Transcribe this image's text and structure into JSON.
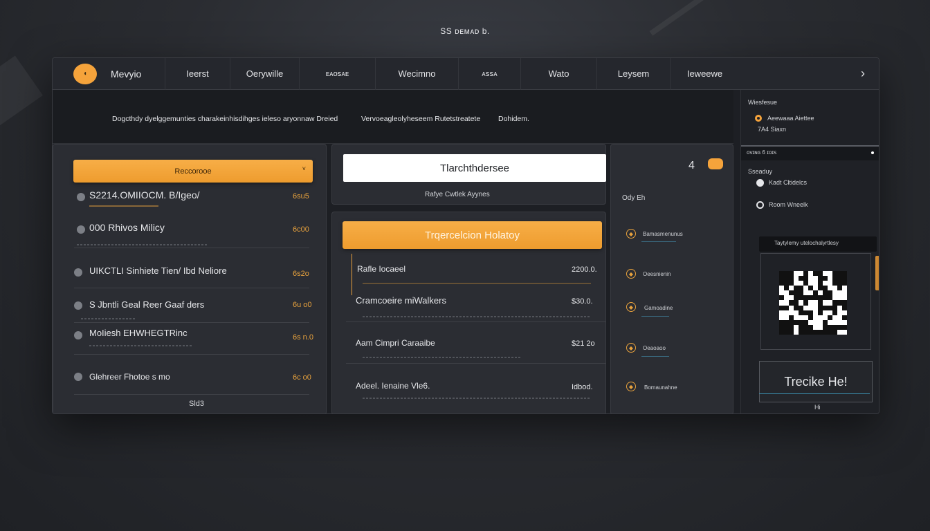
{
  "page": {
    "caption": "SS ᴅᴇᴍᴀᴅ b."
  },
  "nav": {
    "brand": "Mevyio",
    "tabs": [
      "Ieerst",
      "Oerywille",
      "ᴇᴀᴏꜱᴀᴇ",
      "Wecimno",
      "ᴀꜱꜱᴀ",
      "Wato",
      "Leysem",
      "Ieweewe"
    ],
    "next_icon": "chevron-right-icon"
  },
  "banner": {
    "text_left": "Dogcthdy dyelggemunties charakeinhisdihges ieleso aryonnaw Dreied",
    "text_mid": "Vervoeagleolyheseem Rutetstreatete",
    "text_right": "Dohidem."
  },
  "left_panel": {
    "button": "Reccorooe",
    "button_caret": "˅",
    "items": [
      {
        "label": "S2214.OMIIOCM. B/Igeo/",
        "value": "6su5"
      },
      {
        "label": "000 Rhivos Milicy",
        "value": "6c00"
      },
      {
        "label": "UIKCTLI Sinhiete Tien/ Ibd Neliore",
        "value": "6s2o"
      },
      {
        "label": "S Jbntli Geal Reer Gaaf ders",
        "value": "6u o0"
      },
      {
        "label": "MoIiesh EHWHEGTRinc",
        "value": "6s n.0"
      },
      {
        "label": "Glehreer Fhotoe s mo",
        "value": "6c o0"
      }
    ],
    "footer": "Sld3"
  },
  "mid_panel": {
    "search_value": "Tlarchthdersee",
    "search_sub": "Rafye Cwtlek Ayynes",
    "history_button": "Trqercelcion Holatoy",
    "transactions": [
      {
        "label": "Rafle Iocaeel",
        "amount": "2200.0."
      },
      {
        "label": "Cramcoeire miWalkers",
        "amount": "$30.0."
      },
      {
        "label": "Aam Cimpri Caraaibe",
        "amount": "$21 2o"
      },
      {
        "label": "Adeel. Ienaine Vle6.",
        "amount": "Idbod."
      }
    ]
  },
  "right_mid_panel": {
    "header_num": "4",
    "header_sub": "Ody  Eh",
    "items": [
      "Bamasmenunus",
      "Oeesnienin",
      "Gamoadine",
      "Oeaoaoo",
      "Bomaunahne"
    ]
  },
  "side": {
    "section1_title": "Wiesfesue",
    "option1": "Aeewaaa Aiettee",
    "option1_sub": "7A4 Siaxn",
    "bar_label": "ᴏᴠɪɴɢ 6  ɪᴏɪꜱ",
    "section2_title": "Sseaduy",
    "option2": "Kadt Cltidelcs",
    "option3": "Room Wneelk",
    "qr_title": "Taytylemy utelochalyrtlesy",
    "big_label": "Trecike He!",
    "footer": "Hi"
  },
  "colors": {
    "accent": "#f5a33b",
    "panel": "#2b2d33",
    "background": "#1d1f24"
  }
}
